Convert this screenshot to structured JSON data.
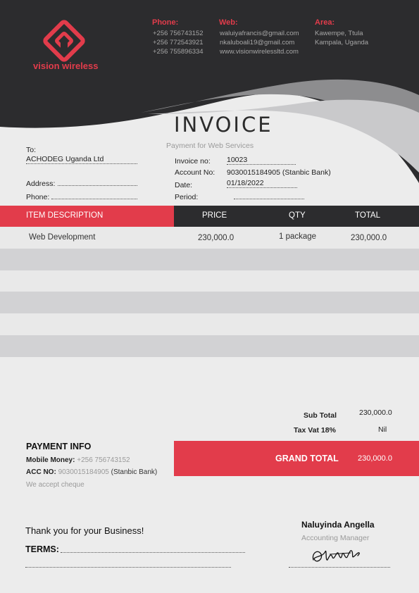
{
  "brand": {
    "name": "vision wireless",
    "accent_color": "#e23c4b",
    "dark_color": "#2c2c2e"
  },
  "contacts": {
    "phone": {
      "label": "Phone:",
      "lines": [
        "+256 756743152",
        "+256 772543921",
        "+256 755896334"
      ]
    },
    "web": {
      "label": "Web:",
      "lines": [
        "waluiyafrancis@gmail.com",
        "nkaluboali19@gmail.com",
        "www.visionwirelessltd.com"
      ]
    },
    "area": {
      "label": "Area:",
      "lines": [
        "Kawempe, Ttula",
        "Kampala, Uganda"
      ]
    }
  },
  "invoice": {
    "title": "INVOICE",
    "subtitle": "Payment for Web Services"
  },
  "bill_to": {
    "to_label": "To:",
    "to_value": "ACHODEG Uganda Ltd",
    "address_label": "Address:",
    "phone_label": "Phone:"
  },
  "meta": {
    "invoice_no_label": "Invoice no:",
    "invoice_no": "10023",
    "account_no_label": "Account No:",
    "account_no": "9030015184905 (Stanbic Bank)",
    "date_label": "Date:",
    "date": "01/18/2022",
    "period_label": "Period:"
  },
  "table": {
    "headers": {
      "description": "ITEM DESCRIPTION",
      "price": "PRICE",
      "qty": "QTY",
      "total": "TOTAL"
    },
    "rows": [
      {
        "description": "Web Development",
        "price": "230,000.0",
        "qty": "1 package",
        "total": "230,000.0"
      }
    ]
  },
  "totals": {
    "subtotal_label": "Sub Total",
    "subtotal": "230,000.0",
    "tax_label": "Tax Vat 18%",
    "tax": "Nil",
    "grand_label": "GRAND TOTAL",
    "grand": "230,000.0"
  },
  "payment": {
    "title": "PAYMENT INFO",
    "mobile_label": "Mobile Money:",
    "mobile_value": "+256 756743152",
    "acc_label": "ACC NO:",
    "acc_value": "9030015184905",
    "acc_bank": "(Stanbic Bank)",
    "note": "We accept cheque"
  },
  "footer": {
    "thanks": "Thank you for your Business!",
    "terms_label": "TERMS:",
    "signer_name": "Naluyinda Angella",
    "signer_role": "Accounting Manager"
  }
}
